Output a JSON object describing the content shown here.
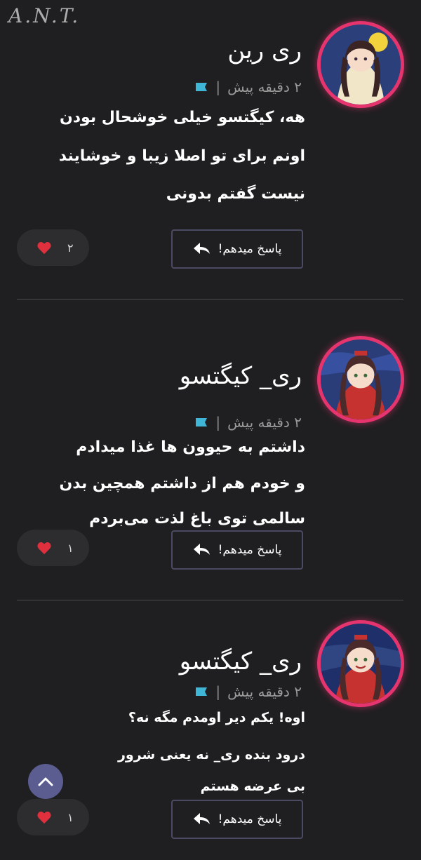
{
  "watermark": "A.N.T.",
  "comments": [
    {
      "username": "ری رین",
      "time": "۲ دقیقه پیش",
      "lines": [
        "هه، کیگتسو خیلی خوشحال بودن",
        "اونم برای تو اصلا زیبا و خوشایند",
        "نیست گفتم بدونی"
      ],
      "reply_label": "پاسخ میدهم!",
      "likes": "۲"
    },
    {
      "username": "ری_ کیگتسو",
      "time": "۲ دقیقه پیش",
      "lines": [
        "داشتم به حیوون ها غذا میدادم",
        "و خودم هم از داشتم همچین بدن",
        "سالمی توی باغ لذت می‌بردم"
      ],
      "reply_label": "پاسخ میدهم!",
      "likes": "۱"
    },
    {
      "username": "ری_ کیگتسو",
      "time": "۲ دقیقه پیش",
      "lines": [
        "اوه! یکم دیر اومدم مگه نه؟",
        "درود بنده ری_ نه یعنی شرور",
        "بی عرضه هستم"
      ],
      "reply_label": "پاسخ میدهم!",
      "likes": "۱"
    }
  ],
  "colors": {
    "background": "#1f1f21",
    "avatar_ring": "#e6346f",
    "flag": "#3fb6d6",
    "heart": "#e0303d",
    "scroll_button": "#5b5d91"
  },
  "icons": [
    "flag-icon",
    "reply-arrow-icon",
    "heart-icon",
    "chevron-up-icon"
  ]
}
